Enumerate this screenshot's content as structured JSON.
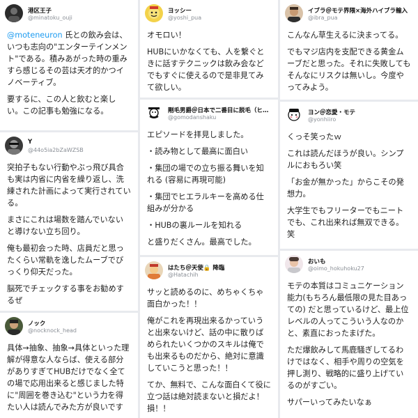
{
  "col1": {
    "card1": {
      "name": "港区王子",
      "handle": "@minatoku_ouji",
      "mention": "@moteneuron",
      "p1_rest": " 氏との飲み会は、いつも志向の\"エンターテインメント\"である。積みあがった時の重みすら感じるその芸は天才的かつイノベーティブ。",
      "p2": "要するに、この人と飲むと楽しい。この記事も勉強になる。"
    },
    "card2": {
      "name": "Y",
      "handle": "@44o5ia2bZaWZSB",
      "p1": "突拍子もない行動やぶっ飛び具合も実は内省に内省を繰り返し、洗練された計画によって実行されている。",
      "p2": "まさにこれは場数を踏んでいないと導けない立ち回り。",
      "p3": "俺も最初会った時、店員だと思ったくらい常軌を逸したムーブでびっくり仰天だった。",
      "p4": "脳死でチェックする事をお勧めするぜ"
    },
    "card3": {
      "name": "ノック",
      "handle": "@nocknock_head",
      "p1": "具体→抽象、抽象→具体といった理解が得意な人ならば、使える部分がありすぎてHUBだけでなく全ての場で応用出来ると感じました特に\"周囲を巻き込む\"という力を得たい人は読んでみた方が良いです"
    }
  },
  "col2": {
    "card1": {
      "name": "ヨッシー",
      "handle": "@yoshi_pua",
      "p1": "オモロい！",
      "p2": "HUBにいかなくても、人を繋ぐときに話すテクニックは飲み会などでもすぐに使えるので是非見てみて欲しい。"
    },
    "card2": {
      "name": "剛毛男爵＠日本で二番目に脱毛（ヒ…",
      "handle": "@gomodanshaku",
      "p1": "エピソードを拝見しました。",
      "p2": "・読み物として最高に面白い",
      "p3": "・集団の場での立ち振る舞いを知れる (容易に再現可能)",
      "p4": "・集団でヒエラルキーを高める仕組みが分かる",
      "p5": "・HUBの裏ルールを知れる",
      "p6": "と盛りだくさん。最高でした。"
    },
    "card3": {
      "name": "はたち＠天使🔒 降臨",
      "handle": "@Hatachih",
      "p1": "サッと読めるのに、めちゃくちゃ面白かった！！",
      "p2": "俺がこれを再現出来るかっていうと出来ないけど、話の中に散りばめられたいくつかのスキルは俺でも出来るものだから、絶対に意識していこうと思った！！",
      "p3": "てか、無料で、こんな面白くて役に立つ話は絶対読まないと損だよ！損！！"
    }
  },
  "col3": {
    "card1": {
      "name": "イブラ＠モテ界隈×海外ハイブラ輸入",
      "handle": "@ibra_pua",
      "p1": "こんなん草生えるに決まってる。",
      "p2": "でもマジ店内を支配できる黄金ムーブだと思った。それに失敗してもそんなにリスクは無いし。今度やってみよう。"
    },
    "card2": {
      "name": "ヨン＠恋愛・モテ",
      "handle": "@yonhiiro",
      "p1": "くっそ笑ったｗ",
      "p2": "これは読んだほうが良い。シンプルにおもろい笑",
      "p3": "「お金が無かった」からこその発想力。",
      "p4": "大学生でもフリーターでもニートでも、これ出来れば無双できる。笑"
    },
    "card3": {
      "name": "おいも",
      "handle": "@oimo_hokuhoku27",
      "p1": "モテの本質はコミュニケーション能力(もちろん最低限の見た目あっての) だと思っているけど、最上位レベルの人ってこういう人なのかと、素直におったまげた。",
      "p2": "ただ爆飲みして馬鹿騒ぎしてるわけではなく、相手や周りの空気を押し測り、戦略的に盛り上げているのがすごい。",
      "p3": "サパーいってみたいなぁ"
    }
  }
}
